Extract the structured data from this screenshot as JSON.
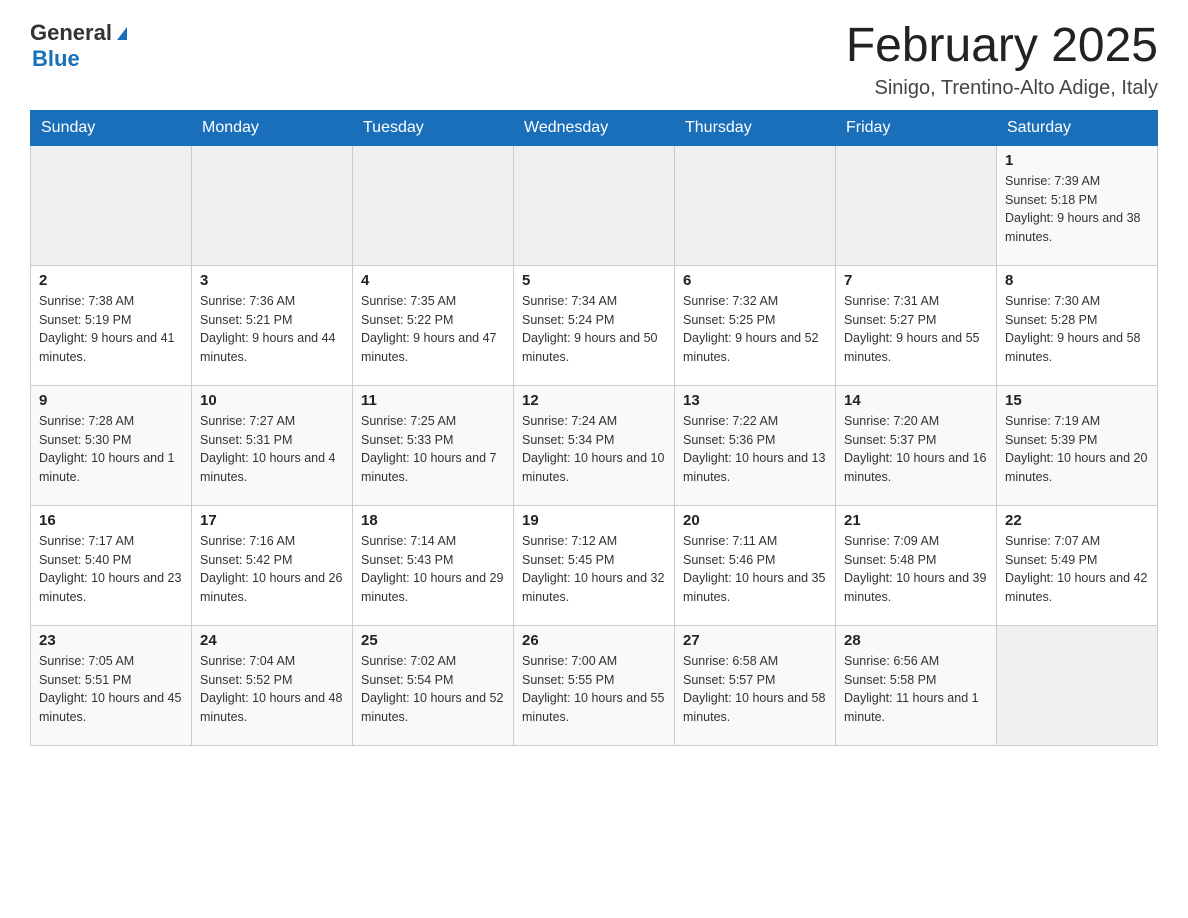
{
  "header": {
    "logo_general": "General",
    "logo_blue": "Blue",
    "month_title": "February 2025",
    "location": "Sinigo, Trentino-Alto Adige, Italy"
  },
  "weekdays": [
    "Sunday",
    "Monday",
    "Tuesday",
    "Wednesday",
    "Thursday",
    "Friday",
    "Saturday"
  ],
  "weeks": [
    [
      {
        "day": "",
        "info": ""
      },
      {
        "day": "",
        "info": ""
      },
      {
        "day": "",
        "info": ""
      },
      {
        "day": "",
        "info": ""
      },
      {
        "day": "",
        "info": ""
      },
      {
        "day": "",
        "info": ""
      },
      {
        "day": "1",
        "info": "Sunrise: 7:39 AM\nSunset: 5:18 PM\nDaylight: 9 hours and 38 minutes."
      }
    ],
    [
      {
        "day": "2",
        "info": "Sunrise: 7:38 AM\nSunset: 5:19 PM\nDaylight: 9 hours and 41 minutes."
      },
      {
        "day": "3",
        "info": "Sunrise: 7:36 AM\nSunset: 5:21 PM\nDaylight: 9 hours and 44 minutes."
      },
      {
        "day": "4",
        "info": "Sunrise: 7:35 AM\nSunset: 5:22 PM\nDaylight: 9 hours and 47 minutes."
      },
      {
        "day": "5",
        "info": "Sunrise: 7:34 AM\nSunset: 5:24 PM\nDaylight: 9 hours and 50 minutes."
      },
      {
        "day": "6",
        "info": "Sunrise: 7:32 AM\nSunset: 5:25 PM\nDaylight: 9 hours and 52 minutes."
      },
      {
        "day": "7",
        "info": "Sunrise: 7:31 AM\nSunset: 5:27 PM\nDaylight: 9 hours and 55 minutes."
      },
      {
        "day": "8",
        "info": "Sunrise: 7:30 AM\nSunset: 5:28 PM\nDaylight: 9 hours and 58 minutes."
      }
    ],
    [
      {
        "day": "9",
        "info": "Sunrise: 7:28 AM\nSunset: 5:30 PM\nDaylight: 10 hours and 1 minute."
      },
      {
        "day": "10",
        "info": "Sunrise: 7:27 AM\nSunset: 5:31 PM\nDaylight: 10 hours and 4 minutes."
      },
      {
        "day": "11",
        "info": "Sunrise: 7:25 AM\nSunset: 5:33 PM\nDaylight: 10 hours and 7 minutes."
      },
      {
        "day": "12",
        "info": "Sunrise: 7:24 AM\nSunset: 5:34 PM\nDaylight: 10 hours and 10 minutes."
      },
      {
        "day": "13",
        "info": "Sunrise: 7:22 AM\nSunset: 5:36 PM\nDaylight: 10 hours and 13 minutes."
      },
      {
        "day": "14",
        "info": "Sunrise: 7:20 AM\nSunset: 5:37 PM\nDaylight: 10 hours and 16 minutes."
      },
      {
        "day": "15",
        "info": "Sunrise: 7:19 AM\nSunset: 5:39 PM\nDaylight: 10 hours and 20 minutes."
      }
    ],
    [
      {
        "day": "16",
        "info": "Sunrise: 7:17 AM\nSunset: 5:40 PM\nDaylight: 10 hours and 23 minutes."
      },
      {
        "day": "17",
        "info": "Sunrise: 7:16 AM\nSunset: 5:42 PM\nDaylight: 10 hours and 26 minutes."
      },
      {
        "day": "18",
        "info": "Sunrise: 7:14 AM\nSunset: 5:43 PM\nDaylight: 10 hours and 29 minutes."
      },
      {
        "day": "19",
        "info": "Sunrise: 7:12 AM\nSunset: 5:45 PM\nDaylight: 10 hours and 32 minutes."
      },
      {
        "day": "20",
        "info": "Sunrise: 7:11 AM\nSunset: 5:46 PM\nDaylight: 10 hours and 35 minutes."
      },
      {
        "day": "21",
        "info": "Sunrise: 7:09 AM\nSunset: 5:48 PM\nDaylight: 10 hours and 39 minutes."
      },
      {
        "day": "22",
        "info": "Sunrise: 7:07 AM\nSunset: 5:49 PM\nDaylight: 10 hours and 42 minutes."
      }
    ],
    [
      {
        "day": "23",
        "info": "Sunrise: 7:05 AM\nSunset: 5:51 PM\nDaylight: 10 hours and 45 minutes."
      },
      {
        "day": "24",
        "info": "Sunrise: 7:04 AM\nSunset: 5:52 PM\nDaylight: 10 hours and 48 minutes."
      },
      {
        "day": "25",
        "info": "Sunrise: 7:02 AM\nSunset: 5:54 PM\nDaylight: 10 hours and 52 minutes."
      },
      {
        "day": "26",
        "info": "Sunrise: 7:00 AM\nSunset: 5:55 PM\nDaylight: 10 hours and 55 minutes."
      },
      {
        "day": "27",
        "info": "Sunrise: 6:58 AM\nSunset: 5:57 PM\nDaylight: 10 hours and 58 minutes."
      },
      {
        "day": "28",
        "info": "Sunrise: 6:56 AM\nSunset: 5:58 PM\nDaylight: 11 hours and 1 minute."
      },
      {
        "day": "",
        "info": ""
      }
    ]
  ]
}
